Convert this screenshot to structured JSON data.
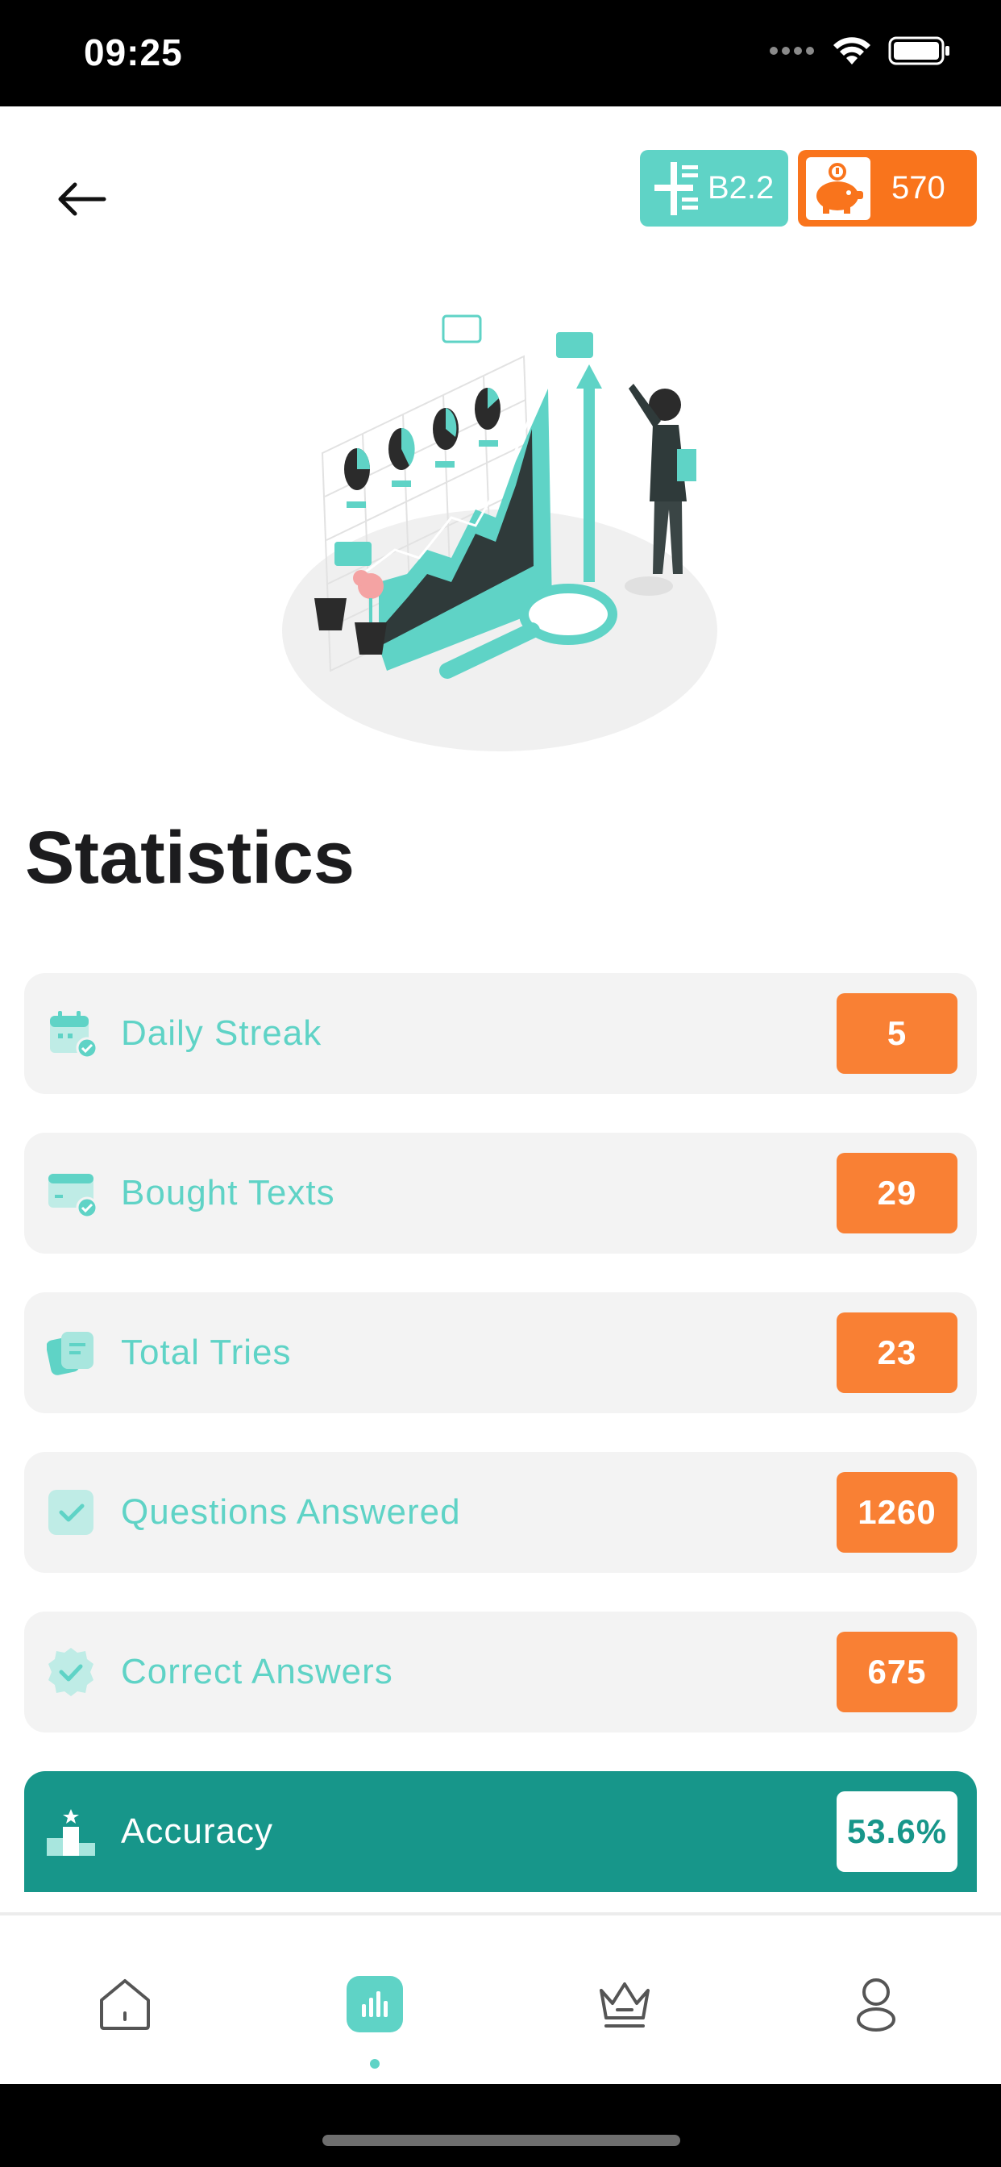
{
  "status_bar": {
    "time": "09:25"
  },
  "header": {
    "level_badge": "B2.2",
    "coins": "570"
  },
  "page": {
    "title": "Statistics"
  },
  "stats": [
    {
      "label": "Daily Streak",
      "value": "5",
      "icon": "calendar-check-icon"
    },
    {
      "label": "Bought Texts",
      "value": "29",
      "icon": "card-check-icon"
    },
    {
      "label": "Total Tries",
      "value": "23",
      "icon": "notes-icon"
    },
    {
      "label": "Questions Answered",
      "value": "1260",
      "icon": "checkbox-icon"
    },
    {
      "label": "Correct Answers",
      "value": "675",
      "icon": "badge-check-icon"
    },
    {
      "label": "Accuracy",
      "value": "53.6%",
      "icon": "podium-icon"
    }
  ],
  "tabs": [
    {
      "icon": "home-icon",
      "active": false
    },
    {
      "icon": "bar-chart-icon",
      "active": true
    },
    {
      "icon": "crown-icon",
      "active": false
    },
    {
      "icon": "profile-icon",
      "active": false
    }
  ],
  "colors": {
    "accent_teal": "#5fd3c6",
    "dark_teal": "#17968a",
    "orange": "#f98034",
    "row_bg": "#f3f3f3"
  }
}
